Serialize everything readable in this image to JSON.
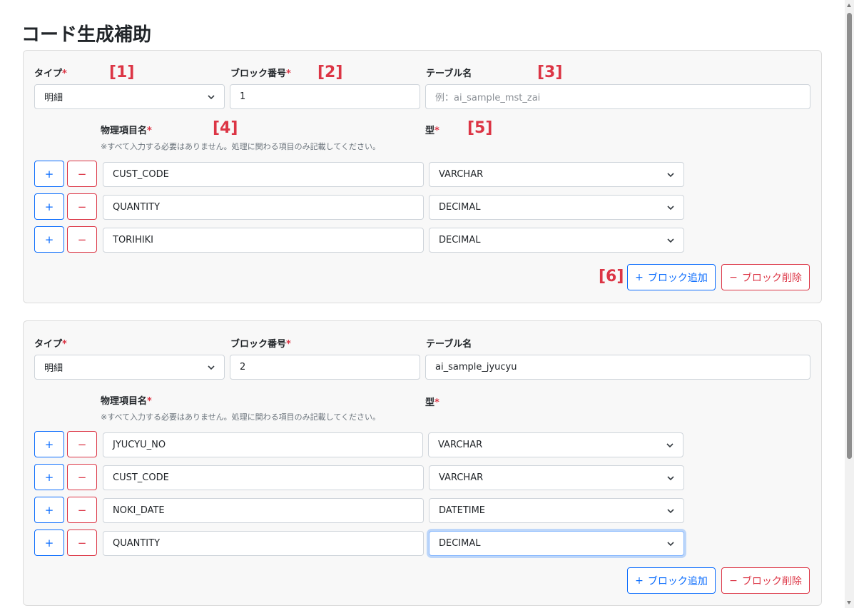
{
  "page": {
    "title": "コード生成補助"
  },
  "labels": {
    "type": "タイプ",
    "block_no": "ブロック番号",
    "table_name": "テーブル名",
    "field_name": "物理項目名",
    "field_type": "型",
    "required_mark": "*",
    "note": "※すべて入力する必要はありません。処理に関わる項目のみ記載してください。",
    "add_row": "+",
    "remove_row": "−",
    "add_block": "ブロック追加",
    "add_block_icon": "+",
    "delete_block": "ブロック削除",
    "delete_block_icon": "−"
  },
  "annotations": [
    "[1]",
    "[2]",
    "[3]",
    "[4]",
    "[5]",
    "[6]"
  ],
  "blocks": [
    {
      "type": "明細",
      "block_no": "1",
      "table_name": "",
      "table_placeholder": "例：ai_sample_mst_zai",
      "fields": [
        {
          "name": "CUST_CODE",
          "type": "VARCHAR"
        },
        {
          "name": "QUANTITY",
          "type": "DECIMAL"
        },
        {
          "name": "TORIHIKI",
          "type": "DECIMAL"
        }
      ]
    },
    {
      "type": "明細",
      "block_no": "2",
      "table_name": "ai_sample_jyucyu",
      "table_placeholder": "",
      "fields": [
        {
          "name": "JYUCYU_NO",
          "type": "VARCHAR"
        },
        {
          "name": "CUST_CODE",
          "type": "VARCHAR"
        },
        {
          "name": "NOKI_DATE",
          "type": "DATETIME"
        },
        {
          "name": "QUANTITY",
          "type": "DECIMAL"
        }
      ]
    }
  ],
  "colors": {
    "primary": "#0d6efd",
    "danger": "#dc3545",
    "panel_bg": "#f8f8f8"
  }
}
